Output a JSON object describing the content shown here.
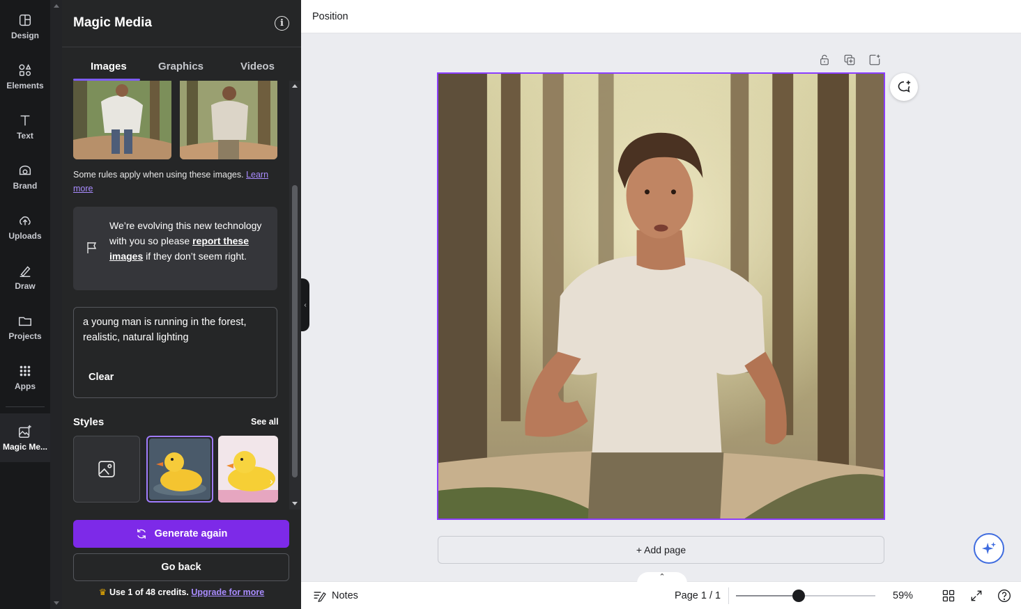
{
  "rail": {
    "items": [
      {
        "label": "Design",
        "icon": "design-icon"
      },
      {
        "label": "Elements",
        "icon": "elements-icon"
      },
      {
        "label": "Text",
        "icon": "text-icon"
      },
      {
        "label": "Brand",
        "icon": "brand-icon"
      },
      {
        "label": "Uploads",
        "icon": "uploads-icon"
      },
      {
        "label": "Draw",
        "icon": "draw-icon"
      },
      {
        "label": "Projects",
        "icon": "projects-icon"
      },
      {
        "label": "Apps",
        "icon": "apps-icon"
      },
      {
        "label": "Magic Me...",
        "icon": "magic-media-icon"
      }
    ]
  },
  "panel": {
    "title": "Magic Media",
    "tabs": [
      "Images",
      "Graphics",
      "Videos"
    ],
    "rules_text": "Some rules apply when using these images.",
    "rules_link": "Learn more",
    "evolve_pre": "We’re evolving this new technology with you so please",
    "evolve_link": "report these images",
    "evolve_post": "if they don’t seem right.",
    "prompt": "a young man is running in the forest, realistic, natural lighting",
    "clear_label": "Clear",
    "styles_label": "Styles",
    "see_all_label": "See all",
    "generate_label": "Generate again",
    "back_label": "Go back",
    "credits_text": "Use 1 of 48 credits.",
    "credits_link": "Upgrade for more"
  },
  "topbar": {
    "position_label": "Position"
  },
  "canvas": {
    "add_page_label": "+ Add page"
  },
  "bottombar": {
    "notes_label": "Notes",
    "page_indicator": "Page 1 / 1",
    "zoom_percent": "59%",
    "zoom_level": 0.45
  },
  "colors": {
    "accent": "#7d2ae8",
    "selection": "#8b3dff",
    "panel_bg": "#252627",
    "rail_bg": "#18191b"
  }
}
